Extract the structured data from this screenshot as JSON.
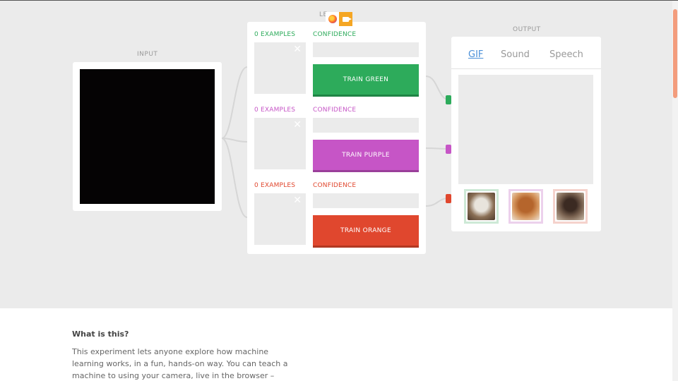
{
  "sections": {
    "input": "INPUT",
    "learning_partial": "LE",
    "output": "OUTPUT"
  },
  "rows": [
    {
      "examples": "0 EXAMPLES",
      "confidence": "CONFIDENCE",
      "button": "TRAIN GREEN",
      "color": "#2dab5b",
      "shadow": "#1f8445"
    },
    {
      "examples": "0 EXAMPLES",
      "confidence": "CONFIDENCE",
      "button": "TRAIN PURPLE",
      "color": "#c655c6",
      "shadow": "#9a3f9a"
    },
    {
      "examples": "0 EXAMPLES",
      "confidence": "CONFIDENCE",
      "button": "TRAIN ORANGE",
      "color": "#e0472e",
      "shadow": "#b23822"
    }
  ],
  "output": {
    "tabs": [
      "GIF",
      "Sound",
      "Speech"
    ],
    "active_tab": "GIF",
    "thumb_border_colors": [
      "#cde9d6",
      "#ecd1ec",
      "#f5d2cc"
    ]
  },
  "close_glyph": "✕",
  "info": {
    "title": "What is this?",
    "body": "This experiment lets anyone explore how machine learning works, in a fun, hands-on way. You can teach a machine to using your camera, live in the browser –"
  }
}
